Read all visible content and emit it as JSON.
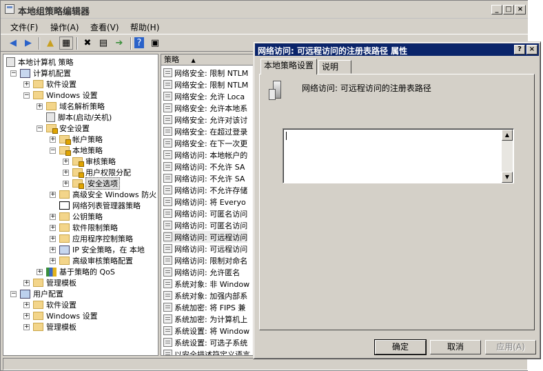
{
  "window": {
    "title": "本地组策略编辑器",
    "controls": [
      "_",
      "□",
      "×"
    ]
  },
  "menu": [
    "文件(F)",
    "操作(A)",
    "查看(V)",
    "帮助(H)"
  ],
  "toolbar_icons": [
    "back-icon",
    "forward-icon",
    "up-folder-icon",
    "show-tree-icon",
    "delete-icon",
    "properties-icon",
    "export-icon",
    "help-icon",
    "view-icon"
  ],
  "tree": {
    "root": "本地计算机 策略",
    "computer_config": "计算机配置",
    "software_settings": "软件设置",
    "windows_settings": "Windows 设置",
    "dns": "域名解析策略",
    "scripts": "脚本(启动/关机)",
    "security_settings": "安全设置",
    "account_policies": "帐户策略",
    "local_policies": "本地策略",
    "audit_policy": "审核策略",
    "user_rights": "用户权限分配",
    "security_options": "安全选项",
    "advanced_firewall": "高级安全 Windows 防火",
    "network_list": "网络列表管理器策略",
    "public_key": "公钥策略",
    "software_restriction": "软件限制策略",
    "app_control": "应用程序控制策略",
    "ip_security": "IP 安全策略，在 本地",
    "advanced_audit": "高级审核策略配置",
    "qos": "基于策略的 QoS",
    "admin_templates": "管理模板",
    "user_config": "用户配置",
    "u_software_settings": "软件设置",
    "u_windows_settings": "Windows 设置",
    "u_admin_templates": "管理模板"
  },
  "list": {
    "header": "策略",
    "rows": [
      "网络安全: 限制 NTLM",
      "网络安全: 限制 NTLM",
      "网络安全: 允许 Loca",
      "网络安全: 允许本地系",
      "网络安全: 允许对该讨",
      "网络安全: 在超过登录",
      "网络安全: 在下一次更",
      "网络访问: 本地帐户的",
      "网络访问: 不允许 SA",
      "网络访问: 不允许 SA",
      "网络访问: 不允许存储",
      "网络访问: 将 Everyo",
      "网络访问: 可匿名访问",
      "网络访问: 可匿名访问",
      "网络访问: 可远程访问",
      "网络访问: 可远程访问",
      "网络访问: 限制对命名",
      "网络访问: 允许匿名",
      "系统对象: 非 Window",
      "系统对象: 加强内部系",
      "系统加密: 将 FIPS 兼",
      "系统加密: 为计算机上",
      "系统设置: 将 Window",
      "系统设置: 可选子系统",
      "以安全描述符定义语言"
    ],
    "highlighted_index": 14
  },
  "dialog": {
    "title": "网络访问: 可远程访问的注册表路径 属性",
    "help_btn": "?",
    "close_btn": "×",
    "tabs": [
      "本地策略设置",
      "说明"
    ],
    "policy_name": "网络访问: 可远程访问的注册表路径",
    "textarea_value": "",
    "ok": "确定",
    "cancel": "取消",
    "apply": "应用(A)"
  }
}
